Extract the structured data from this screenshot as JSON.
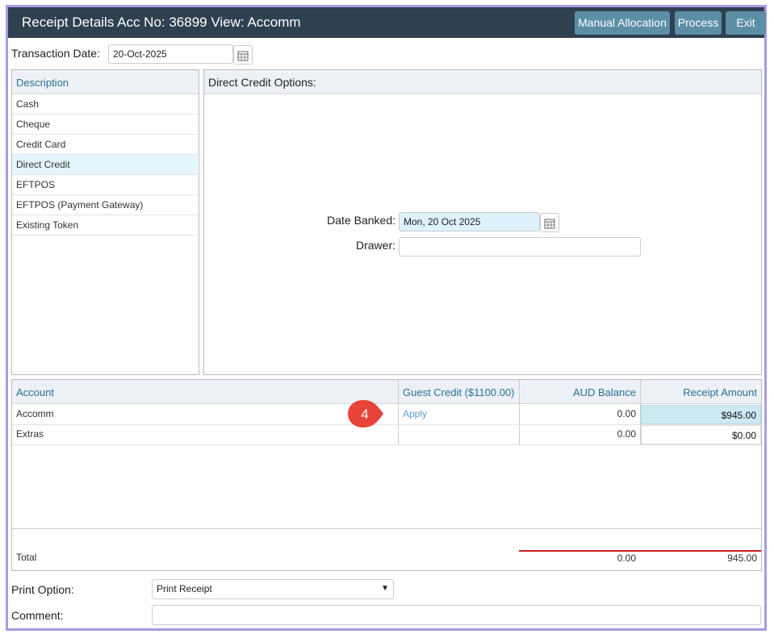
{
  "window": {
    "title": "Receipt Details Acc No: 36899 View: Accomm",
    "buttons": {
      "manual_allocation": "Manual Allocation",
      "process": "Process",
      "exit": "Exit"
    }
  },
  "transaction": {
    "label": "Transaction Date:",
    "value": "20-Oct-2025"
  },
  "payment_types": {
    "header": "Description",
    "items": [
      "Cash",
      "Cheque",
      "Credit Card",
      "Direct Credit",
      "EFTPOS",
      "EFTPOS (Payment Gateway)",
      "Existing Token"
    ],
    "selected": "Direct Credit"
  },
  "options": {
    "header": "Direct Credit Options:",
    "date_banked": {
      "label": "Date Banked:",
      "value": "Mon, 20 Oct 2025"
    },
    "drawer": {
      "label": "Drawer:",
      "value": ""
    }
  },
  "accounts": {
    "headers": {
      "account": "Account",
      "guest_credit": "Guest Credit ($1100.00)",
      "balance": "AUD Balance",
      "receipt": "Receipt Amount"
    },
    "rows": [
      {
        "account": "Accomm",
        "guest_credit": "Apply",
        "balance": "0.00",
        "receipt": "$945.00"
      },
      {
        "account": "Extras",
        "guest_credit": "",
        "balance": "0.00",
        "receipt": "$0.00"
      }
    ],
    "total": {
      "label": "Total",
      "balance": "0.00",
      "receipt": "945.00"
    }
  },
  "callout": {
    "number": "4",
    "color": "#e8443a"
  },
  "print_option": {
    "label": "Print Option:",
    "value": "Print Receipt"
  },
  "comment": {
    "label": "Comment:",
    "value": ""
  },
  "colors": {
    "titlebar": "#2f4050",
    "button": "#5c8ea6",
    "border": "#a99be4",
    "link": "#5b9bd5"
  }
}
